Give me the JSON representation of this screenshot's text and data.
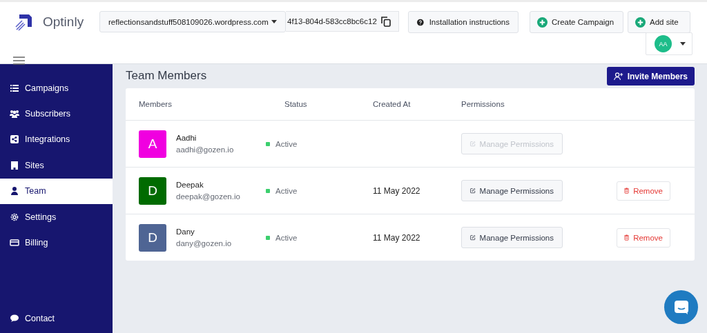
{
  "header": {
    "logo_text": "Optinly",
    "site_select": {
      "value": "reflectionsandstuff508109026.wordpress.com"
    },
    "site_key": {
      "value": "4f13-804d-583cc8bc6c12"
    },
    "buttons": [
      {
        "kind": "help",
        "label": "Installation instructions"
      },
      {
        "kind": "add",
        "label": "Create Campaign"
      },
      {
        "kind": "add",
        "label": "Add site"
      }
    ],
    "avatar": {
      "initials": "AA"
    }
  },
  "sidebar": {
    "items": [
      {
        "label": "Campaigns",
        "selected": false
      },
      {
        "label": "Subscribers",
        "selected": false
      },
      {
        "label": "Integrations",
        "selected": false
      },
      {
        "label": "Sites",
        "selected": false
      },
      {
        "label": "Team",
        "selected": true
      },
      {
        "label": "Settings",
        "selected": false
      },
      {
        "label": "Billing",
        "selected": false
      }
    ],
    "footer_item": {
      "label": "Contact"
    }
  },
  "page": {
    "title": "Team Members",
    "invite_button": "Invite Members"
  },
  "table": {
    "columns": [
      "Members",
      "Status",
      "Created At",
      "Permissions"
    ],
    "rows": [
      {
        "initial": "A",
        "color": "#f000e0",
        "name": "Aadhi",
        "email": "aadhi@gozen.io",
        "status": "Active",
        "permissions": {
          "label": "Manage Permissions",
          "disabled": true
        }
      },
      {
        "initial": "D",
        "color": "#006b00",
        "name": "Deepak",
        "email": "deepak@gozen.io",
        "status": "Active",
        "created_at": "11 May 2022",
        "permissions": {
          "label": "Manage Permissions",
          "disabled": false
        },
        "remove": "Remove"
      },
      {
        "initial": "D",
        "color": "#4f6594",
        "name": "Dany",
        "email": "dany@gozen.io",
        "status": "Active",
        "created_at": "11 May 2022",
        "permissions": {
          "label": "Manage Permissions",
          "disabled": false
        },
        "remove": "Remove"
      }
    ]
  }
}
